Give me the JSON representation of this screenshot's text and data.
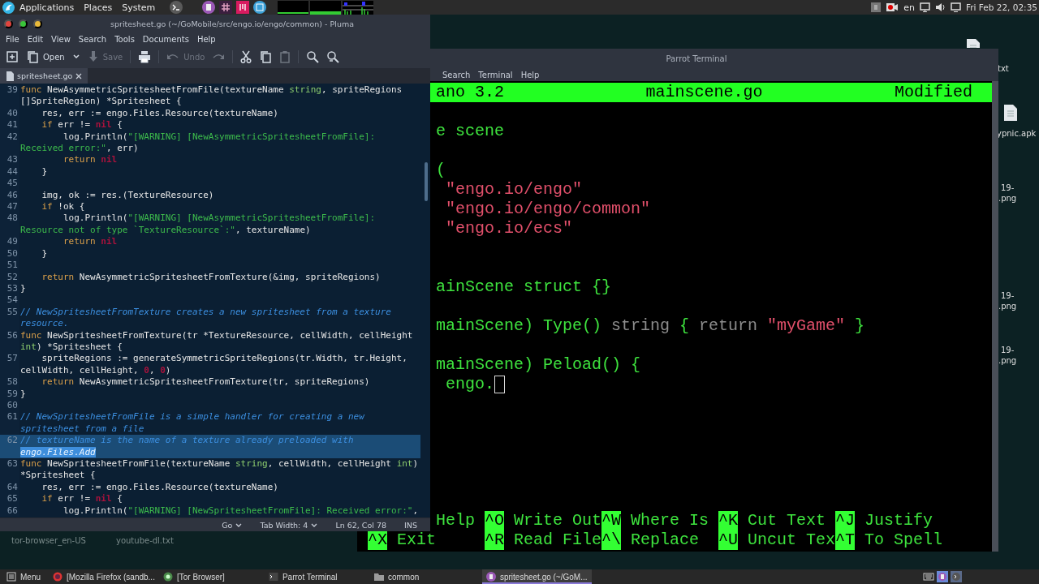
{
  "top_panel": {
    "menus": [
      "Applications",
      "Places",
      "System"
    ],
    "language": "en",
    "clock": "Fri Feb 22, 02:35"
  },
  "desktop": {
    "items": [
      {
        "kind": "file"
      },
      {
        "kind": "label",
        "text": "txt"
      },
      {
        "kind": "file"
      },
      {
        "kind": "label",
        "text": "ypnic.apk"
      },
      {
        "kind": "label",
        "text": "19-"
      },
      {
        "kind": "label",
        "text": ".png"
      },
      {
        "kind": "label",
        "text": "19-"
      },
      {
        "kind": "label",
        "text": ".png"
      },
      {
        "kind": "label",
        "text": "19-"
      },
      {
        "kind": "label",
        "text": ".png"
      },
      {
        "kind": "label",
        "text": "tor-browser_en-US"
      },
      {
        "kind": "label",
        "text": "youtube-dl.txt"
      }
    ]
  },
  "terminal": {
    "title": "Parrot Terminal",
    "menu": [
      "Search",
      "Terminal",
      "Help"
    ],
    "nano": {
      "header": {
        "version": "ano 3.2",
        "file": "mainscene.go",
        "status": "Modified"
      },
      "lines": [
        {
          "parts": [
            {
              "kind": "plain",
              "text": "e scene"
            }
          ]
        },
        {
          "parts": [
            {
              "kind": "plain",
              "text": "("
            }
          ]
        },
        {
          "parts": [
            {
              "kind": "string",
              "text": "\"engo.io/engo\""
            }
          ]
        },
        {
          "parts": [
            {
              "kind": "string",
              "text": "\"engo.io/engo/common\""
            }
          ]
        },
        {
          "parts": [
            {
              "kind": "string",
              "text": "\"engo.io/ecs\""
            }
          ]
        },
        {
          "parts": [
            {
              "kind": "plain",
              "text": "ainScene struct {}"
            }
          ]
        },
        {
          "parts": [
            {
              "kind": "plain",
              "text": "mainScene) Type() "
            },
            {
              "kind": "keyword",
              "text": "string"
            },
            {
              "kind": "plain",
              "text": " { "
            },
            {
              "kind": "keyword",
              "text": "return "
            },
            {
              "kind": "string",
              "text": "\"myGame\""
            },
            {
              "kind": "plain",
              "text": " }"
            }
          ]
        },
        {
          "parts": [
            {
              "kind": "plain",
              "text": "mainScene) Peload() {"
            }
          ]
        },
        {
          "cursor": true,
          "parts": [
            {
              "kind": "plain",
              "text": "engo."
            }
          ]
        }
      ],
      "shortcuts": [
        [
          {
            "label": "Help"
          },
          {
            "key": "^O",
            "label": "Write Out"
          },
          {
            "key": "^W",
            "label": "Where Is"
          },
          {
            "key": "^K",
            "label": "Cut Text"
          },
          {
            "key": "^J",
            "label": "Justify"
          }
        ],
        [
          {
            "key": "^X",
            "label": "Exit"
          },
          {
            "key": "^R",
            "label": "Read File"
          },
          {
            "key": "^\\",
            "label": "Replace"
          },
          {
            "key": "^U",
            "label": "Uncut Tex"
          },
          {
            "key": "^T",
            "label": "To Spell"
          }
        ]
      ]
    }
  },
  "editor": {
    "title": "spritesheet.go (~/GoMobile/src/engo.io/engo/common) - Pluma",
    "menu": [
      "File",
      "Edit",
      "View",
      "Search",
      "Tools",
      "Documents",
      "Help"
    ],
    "toolbar": [
      {
        "kind": "new",
        "disabled": false
      },
      {
        "kind": "open",
        "label": "Open",
        "disabled": false
      },
      {
        "kind": "dropdown",
        "disabled": false
      },
      {
        "kind": "save",
        "label": "Save",
        "disabled": true
      },
      {
        "kind": "print",
        "disabled": false
      },
      {
        "kind": "undo",
        "label": "Undo",
        "disabled": true
      },
      {
        "kind": "redo",
        "disabled": true
      },
      {
        "kind": "cut",
        "disabled": false
      },
      {
        "kind": "copy",
        "disabled": false
      },
      {
        "kind": "paste",
        "disabled": true
      },
      {
        "kind": "find",
        "disabled": false
      },
      {
        "kind": "replace",
        "disabled": false
      }
    ],
    "tabs": [
      {
        "label": "spritesheet.go",
        "selected": true
      }
    ],
    "lines": [
      {
        "number": "39",
        "tokens": [
          {
            "kind": "keyword",
            "text": "func"
          },
          {
            "kind": "plain",
            "text": " NewAsymmetricSpritesheetFromFile(textureName "
          },
          {
            "kind": "type",
            "text": "string"
          },
          {
            "kind": "plain",
            "text": ", spriteRegions []SpriteRegion) *Spritesheet {"
          }
        ]
      },
      {
        "number": "40",
        "tokens": [
          {
            "kind": "plain",
            "text": "    res, err := engo.Files.Resource(textureName)"
          }
        ]
      },
      {
        "number": "41",
        "tokens": [
          {
            "kind": "keyword",
            "text": "    if"
          },
          {
            "kind": "plain",
            "text": " err != "
          },
          {
            "kind": "constant",
            "text": "nil"
          },
          {
            "kind": "plain",
            "text": " {"
          }
        ]
      },
      {
        "number": "42",
        "tokens": [
          {
            "kind": "plain",
            "text": "        log.Println("
          },
          {
            "kind": "string",
            "text": "\"[WARNING] [NewAsymmetricSpritesheetFromFile]: Received error:\""
          },
          {
            "kind": "plain",
            "text": ", err)"
          }
        ]
      },
      {
        "number": "43",
        "tokens": [
          {
            "kind": "keyword",
            "text": "        return "
          },
          {
            "kind": "constant",
            "text": "nil"
          }
        ]
      },
      {
        "number": "44",
        "tokens": [
          {
            "kind": "plain",
            "text": "    }"
          }
        ]
      },
      {
        "number": "45"
      },
      {
        "number": "46",
        "tokens": [
          {
            "kind": "plain",
            "text": "    img, ok := res.(TextureResource)"
          }
        ]
      },
      {
        "number": "47",
        "tokens": [
          {
            "kind": "keyword",
            "text": "    if"
          },
          {
            "kind": "plain",
            "text": " !ok {"
          }
        ]
      },
      {
        "number": "48",
        "tokens": [
          {
            "kind": "plain",
            "text": "        log.Println("
          },
          {
            "kind": "string",
            "text": "\"[WARNING] [NewAsymmetricSpritesheetFromFile]: Resource not of type `TextureResource`:\""
          },
          {
            "kind": "plain",
            "text": ", textureName)"
          }
        ]
      },
      {
        "number": "49",
        "tokens": [
          {
            "kind": "keyword",
            "text": "        return "
          },
          {
            "kind": "constant",
            "text": "nil"
          }
        ]
      },
      {
        "number": "50",
        "tokens": [
          {
            "kind": "plain",
            "text": "    }"
          }
        ]
      },
      {
        "number": "51"
      },
      {
        "number": "52",
        "tokens": [
          {
            "kind": "keyword",
            "text": "    return"
          },
          {
            "kind": "plain",
            "text": " NewAsymmetricSpritesheetFromTexture(&img, spriteRegions)"
          }
        ]
      },
      {
        "number": "53",
        "tokens": [
          {
            "kind": "plain",
            "text": "}"
          }
        ]
      },
      {
        "number": "54"
      },
      {
        "number": "55",
        "tokens": [
          {
            "kind": "comment",
            "text": "// NewSpritesheetFromTexture creates a new spritesheet from a texture resource."
          }
        ]
      },
      {
        "number": "56",
        "tokens": [
          {
            "kind": "keyword",
            "text": "func"
          },
          {
            "kind": "plain",
            "text": " NewSpritesheetFromTexture(tr *TextureResource, cellWidth, cellHeight "
          },
          {
            "kind": "type",
            "text": "int"
          },
          {
            "kind": "plain",
            "text": ") *Spritesheet {"
          }
        ]
      },
      {
        "number": "57",
        "tokens": [
          {
            "kind": "plain",
            "text": "    spriteRegions := generateSymmetricSpriteRegions(tr.Width, tr.Height, cellWidth, cellHeight, "
          },
          {
            "kind": "constant",
            "text": "0"
          },
          {
            "kind": "plain",
            "text": ", "
          },
          {
            "kind": "constant",
            "text": "0"
          },
          {
            "kind": "plain",
            "text": ")"
          }
        ]
      },
      {
        "number": "58",
        "tokens": [
          {
            "kind": "keyword",
            "text": "    return"
          },
          {
            "kind": "plain",
            "text": " NewAsymmetricSpritesheetFromTexture(tr, spriteRegions)"
          }
        ]
      },
      {
        "number": "59",
        "tokens": [
          {
            "kind": "plain",
            "text": "}"
          }
        ]
      },
      {
        "number": "60"
      },
      {
        "number": "61",
        "tokens": [
          {
            "kind": "comment",
            "text": "// NewSpritesheetFromFile is a simple handler for creating a new spritesheet from a file"
          }
        ]
      },
      {
        "number": "62",
        "current": true,
        "tokens": [
          {
            "kind": "comment",
            "text": "// textureName is the name of a texture already preloaded with "
          },
          {
            "kind": "comment",
            "text": "engo.Files.Add",
            "selected": true
          }
        ]
      },
      {
        "number": "63",
        "tokens": [
          {
            "kind": "keyword",
            "text": "func"
          },
          {
            "kind": "plain",
            "text": " NewSpritesheetFromFile(textureName "
          },
          {
            "kind": "type",
            "text": "string"
          },
          {
            "kind": "plain",
            "text": ", cellWidth, cellHeight "
          },
          {
            "kind": "type",
            "text": "int"
          },
          {
            "kind": "plain",
            "text": ") *Spritesheet {"
          }
        ]
      },
      {
        "number": "64",
        "tokens": [
          {
            "kind": "plain",
            "text": "    res, err := engo.Files.Resource(textureName)"
          }
        ]
      },
      {
        "number": "65",
        "tokens": [
          {
            "kind": "keyword",
            "text": "    if"
          },
          {
            "kind": "plain",
            "text": " err != "
          },
          {
            "kind": "constant",
            "text": "nil"
          },
          {
            "kind": "plain",
            "text": " {"
          }
        ]
      },
      {
        "number": "66",
        "tokens": [
          {
            "kind": "plain",
            "text": "        log.Println("
          },
          {
            "kind": "string",
            "text": "\"[WARNING] [NewSpritesheetFromFile]: Received error:\""
          },
          {
            "kind": "plain",
            "text": ","
          }
        ]
      }
    ],
    "status_bar": {
      "language": "Go",
      "tab_width": "Tab Width: 4",
      "position": "Ln 62, Col 78",
      "mode": "INS"
    }
  },
  "taskbar": {
    "menu": "Menu",
    "windows": [
      {
        "kind": "browser",
        "label": "[Mozilla Firefox (sandb...",
        "selected": false
      },
      {
        "kind": "tor",
        "label": "[Tor Browser]",
        "selected": false
      },
      {
        "kind": "terminal",
        "label": "Parrot Terminal",
        "selected": false
      },
      {
        "kind": "folder",
        "label": "common",
        "selected": false
      },
      {
        "kind": "editor",
        "label": "spritesheet.go (~/GoM...",
        "selected": true
      }
    ]
  }
}
